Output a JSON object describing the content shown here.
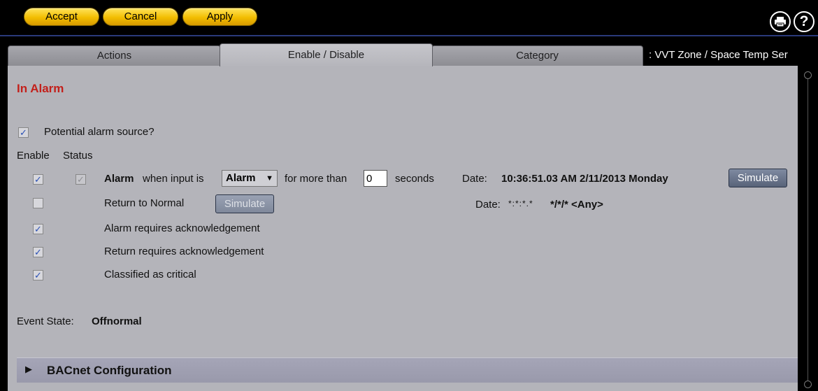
{
  "toolbar": {
    "accept_label": "Accept",
    "cancel_label": "Cancel",
    "apply_label": "Apply",
    "print_icon": "printer-icon",
    "help_icon": "help-icon",
    "help_glyph": "?"
  },
  "tabs": [
    {
      "label": "Actions",
      "active": false
    },
    {
      "label": "Enable / Disable",
      "active": true
    },
    {
      "label": "Category",
      "active": false
    }
  ],
  "object_title": ": VVT Zone / Space Temp Ser",
  "section_title": "In Alarm",
  "potential_source": {
    "label": "Potential alarm source?",
    "checked": true
  },
  "columns": {
    "enable": "Enable",
    "status": "Status"
  },
  "alarm_row": {
    "enable_checked": true,
    "status_checked": true,
    "label_bold": "Alarm",
    "label_rest": "when input is",
    "select_value": "Alarm",
    "for_more_than": "for more than",
    "seconds_value": "0",
    "seconds_label": "seconds",
    "date_label": "Date:",
    "date_value": "10:36:51.03 AM  2/11/2013 Monday",
    "simulate_label": "Simulate"
  },
  "return_row": {
    "enable_checked": false,
    "label": "Return to Normal",
    "simulate_label": "Simulate",
    "date_label": "Date:",
    "date_time": "*:*:*.*",
    "date_value": "*/*/* <Any>"
  },
  "options": [
    {
      "label": "Alarm requires acknowledgement",
      "checked": true
    },
    {
      "label": "Return requires acknowledgement",
      "checked": true
    },
    {
      "label": "Classified as critical",
      "checked": true
    }
  ],
  "event_state": {
    "label": "Event State:",
    "value": "Offnormal"
  },
  "bacnet": {
    "label": "BACnet Configuration"
  },
  "colors": {
    "accent_yellow": "#f2bd00",
    "alarm_red": "#c3201b",
    "panel_gray": "#b4b4ba",
    "check_blue": "#2a50b4"
  },
  "checkmark": "✓"
}
